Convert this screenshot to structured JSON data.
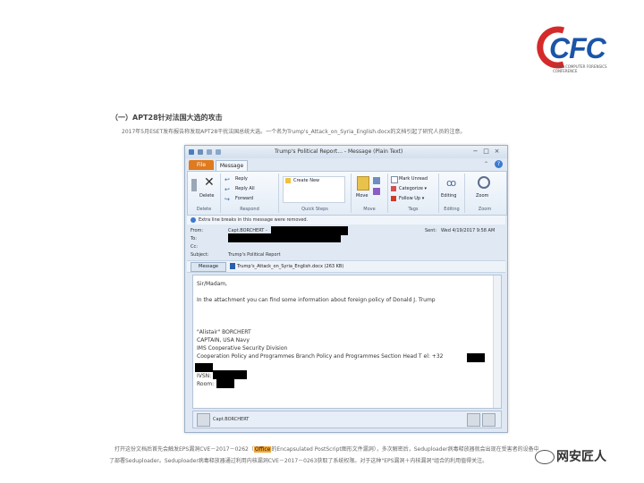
{
  "logo": {
    "text": "CFC",
    "subtitle": "CHINA COMPUTER FORENSICS CONFERENCE",
    "colors": {
      "blue": "#1a55a8",
      "red": "#d42a2a"
    }
  },
  "article": {
    "heading": "（一）APT28针对法国大选的攻击",
    "intro": "2017年5月ESET发布报告称发现APT28干扰法国总统大选。一个名为Trump's_Attack_on_Syria_English.docx的文档引起了研究人员的注意。",
    "footer_line1_pre": "打开这份文档后首先会触发EPS漏洞CVE－2017－0262（",
    "footer_line1_highlight": "Office",
    "footer_line1_post": "的Encapsulated PostScript图形文件漏洞），多次解密后，Seduploader病毒释放器就会出现在受害者的设备中",
    "footer_line2": "了部署Seduploader。Seduploader病毒释放器通过利用内核漏洞CVE－2017－0263获取了系统权限。对于这种\"EPS漏洞＋内核漏洞\"组合的利用值得关注。"
  },
  "window": {
    "title": "Trump's Political Report... - Message (Plain Text)",
    "tabs": {
      "file": "File",
      "message": "Message"
    },
    "ribbon": {
      "delete_group": {
        "delete": "Delete",
        "label": "Delete"
      },
      "respond_group": {
        "reply": "Reply",
        "reply_all": "Reply All",
        "forward": "Forward",
        "label": "Respond"
      },
      "quick_steps": {
        "create_new": "Create New",
        "label": "Quick Steps"
      },
      "move_group": {
        "move": "Move",
        "label": "Move"
      },
      "tags_group": {
        "mark_unread": "Mark Unread",
        "categorize": "Categorize ▾",
        "follow_up": "Follow Up ▾",
        "label": "Tags"
      },
      "editing_group": {
        "editing": "Editing",
        "label": "Editing"
      },
      "zoom_group": {
        "zoom": "Zoom",
        "label": "Zoom"
      }
    },
    "infobar": "Extra line breaks in this message were removed.",
    "headers": {
      "from_label": "From:",
      "from_value": "Capt.BORCHERT - ",
      "to_label": "To:",
      "cc_label": "Cc:",
      "subject_label": "Subject:",
      "subject_value": "Trump's Political Report",
      "sent_label": "Sent:",
      "sent_value": "Wed 4/19/2017 9:58 AM"
    },
    "attachments": {
      "message_tab": "Message",
      "file": "Trump's_Attack_on_Syria_English.docx (263 KB)"
    },
    "body": {
      "greeting": "Sir/Madam,",
      "line1": "In the attachment you can find some information about foreign policy of Donald J. Trump",
      "sig_name": "\"Alistair\" BORCHERT",
      "sig_rank": "CAPTAIN, USA Navy",
      "sig_div": "IMS Cooperative Security Division",
      "sig_branch": "Cooperation Policy and Programmes Branch Policy and Programmes Section Head T el: +32",
      "sig_ivsn": "IVSN:",
      "sig_room": "Room:"
    },
    "sender_bar": "Capt.BORCHERT"
  },
  "watermark": "网安匠人"
}
